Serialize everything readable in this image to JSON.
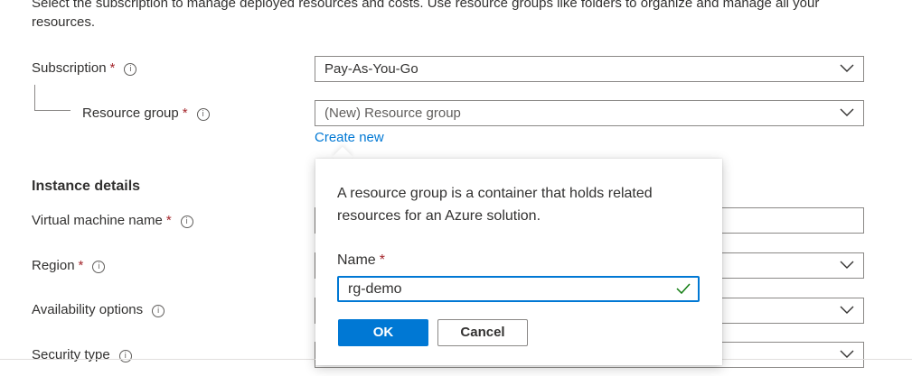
{
  "intro_text": "Select the subscription to manage deployed resources and costs. Use resource groups like folders to organize and manage all your resources.",
  "fields": {
    "subscription": {
      "label": "Subscription",
      "required_mark": "*",
      "value": "Pay-As-You-Go"
    },
    "resource_group": {
      "label": "Resource group",
      "required_mark": "*",
      "value": "(New) Resource group",
      "create_new": "Create new"
    },
    "instance_details_heading": "Instance details",
    "vm_name": {
      "label": "Virtual machine name",
      "required_mark": "*"
    },
    "region": {
      "label": "Region",
      "required_mark": "*"
    },
    "availability": {
      "label": "Availability options"
    },
    "security": {
      "label": "Security type"
    }
  },
  "info_glyph": "i",
  "callout": {
    "description": "A resource group is a container that holds related resources for an Azure solution.",
    "name_label": "Name",
    "name_required_mark": "*",
    "name_value": "rg-demo",
    "ok_label": "OK",
    "cancel_label": "Cancel"
  },
  "colors": {
    "accent": "#0078d4",
    "required": "#a4262c",
    "valid": "#107c10"
  }
}
